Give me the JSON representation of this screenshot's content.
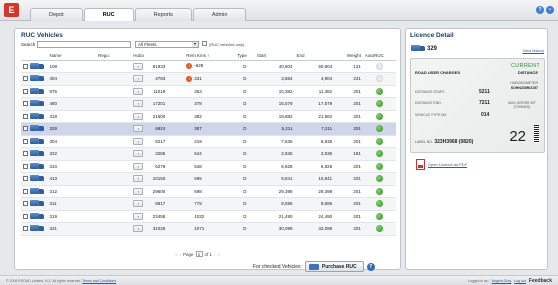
{
  "app": {
    "logo": "E"
  },
  "tabs": [
    {
      "label": "Depot"
    },
    {
      "label": "RUC"
    },
    {
      "label": "Reports"
    },
    {
      "label": "Admin"
    }
  ],
  "main": {
    "title": "RUC Vehicles",
    "search_label": "Search",
    "fleet_select": "All Fleets",
    "ruc_only_label": "(RUC vehicles only)",
    "columns": [
      "Name",
      "Rego.",
      "Hubo",
      "Rem.Kms ↑",
      "Type",
      "Start",
      "End",
      "Weight",
      "AutoRUC"
    ],
    "rows": [
      {
        "name": "108",
        "hubo": "81933",
        "rem": "-628",
        "warn": true,
        "type": "D",
        "start": "40,804",
        "end": "50,904",
        "weight": "121",
        "auto": "off"
      },
      {
        "name": "404",
        "hubo": "4783",
        "rem": "331",
        "warn": true,
        "type": "D",
        "start": "3,884",
        "end": "4,904",
        "weight": "241",
        "auto": "off"
      },
      {
        "name": "875",
        "hubo": "11018",
        "rem": "363",
        "warn": false,
        "type": "D",
        "start": "10,382",
        "end": "11,382",
        "weight": "201",
        "auto": "ok"
      },
      {
        "name": "480",
        "hubo": "17201",
        "rem": "378",
        "warn": false,
        "type": "D",
        "start": "15,579",
        "end": "17,579",
        "weight": "201",
        "auto": "ok"
      },
      {
        "name": "318",
        "hubo": "21600",
        "rem": "382",
        "warn": false,
        "type": "D",
        "start": "19,882",
        "end": "21,982",
        "weight": "201",
        "auto": "ok"
      },
      {
        "name": "329",
        "hubo": "6824",
        "rem": "387",
        "warn": false,
        "type": "D",
        "start": "5,211",
        "end": "7,211",
        "weight": "201",
        "auto": "ok",
        "selected": true
      },
      {
        "name": "304",
        "hubo": "8217",
        "rem": "419",
        "warn": false,
        "type": "D",
        "start": "7,636",
        "end": "8,636",
        "weight": "201",
        "auto": "ok"
      },
      {
        "name": "322",
        "hubo": "3285",
        "rem": "544",
        "warn": false,
        "type": "D",
        "start": "2,836",
        "end": "3,836",
        "weight": "181",
        "auto": "ok"
      },
      {
        "name": "310",
        "hubo": "6279",
        "rem": "548",
        "warn": false,
        "type": "D",
        "start": "6,828",
        "end": "6,828",
        "weight": "201",
        "auto": "ok"
      },
      {
        "name": "413",
        "hubo": "10150",
        "rem": "695",
        "warn": false,
        "type": "D",
        "start": "9,841",
        "end": "10,841",
        "weight": "201",
        "auto": "ok"
      },
      {
        "name": "312",
        "hubo": "29600",
        "rem": "698",
        "warn": false,
        "type": "D",
        "start": "29,398",
        "end": "29,398",
        "weight": "201",
        "auto": "ok"
      },
      {
        "name": "311",
        "hubo": "8817",
        "rem": "779",
        "warn": false,
        "type": "D",
        "start": "8,595",
        "end": "9,595",
        "weight": "201",
        "auto": "ok"
      },
      {
        "name": "319",
        "hubo": "23458",
        "rem": "1032",
        "warn": false,
        "type": "D",
        "start": "21,490",
        "end": "24,490",
        "weight": "201",
        "auto": "ok"
      },
      {
        "name": "321",
        "hubo": "31028",
        "rem": "1071",
        "warn": false,
        "type": "D",
        "start": "30,099",
        "end": "32,099",
        "weight": "201",
        "auto": "ok"
      }
    ],
    "pager": {
      "page_label": "Page",
      "page": "1",
      "of_label": "of 1"
    },
    "checked_label": "For checked Vehicles:",
    "purchase_label": "Purchase RUC"
  },
  "side": {
    "title": "Licence Detail",
    "vehicle": "329",
    "view_history": "View history",
    "licence": {
      "current": "CURRENT",
      "distance": "DISTANCE",
      "ruc_title": "ROAD USER CHARGES",
      "hubo_label": "HUBODOMETER",
      "hubo_id": "SOHN235R/2157",
      "start_label": "DISTANCE START",
      "start_value": "5211",
      "end_label": "DISTANCE END",
      "end_value": "7211",
      "max_weight_label": "MAX GROSS WT (TONNES)",
      "type_label": "VEHICLE TYPE NO.",
      "type_value": "014",
      "big_value": "22",
      "serial_label": "LABEL NO.",
      "serial_value": "323H3968 (0820)"
    },
    "pdf_link": "Open Licence as PDF"
  },
  "footer": {
    "copyright": "© 2009 EROAD Limited, N.Z. All rights reserved.",
    "terms": "Terms and Conditions",
    "logged_in": "Logged in as:",
    "user": "Angela Gray",
    "logout": "Log out",
    "feedback": "Feedback"
  }
}
